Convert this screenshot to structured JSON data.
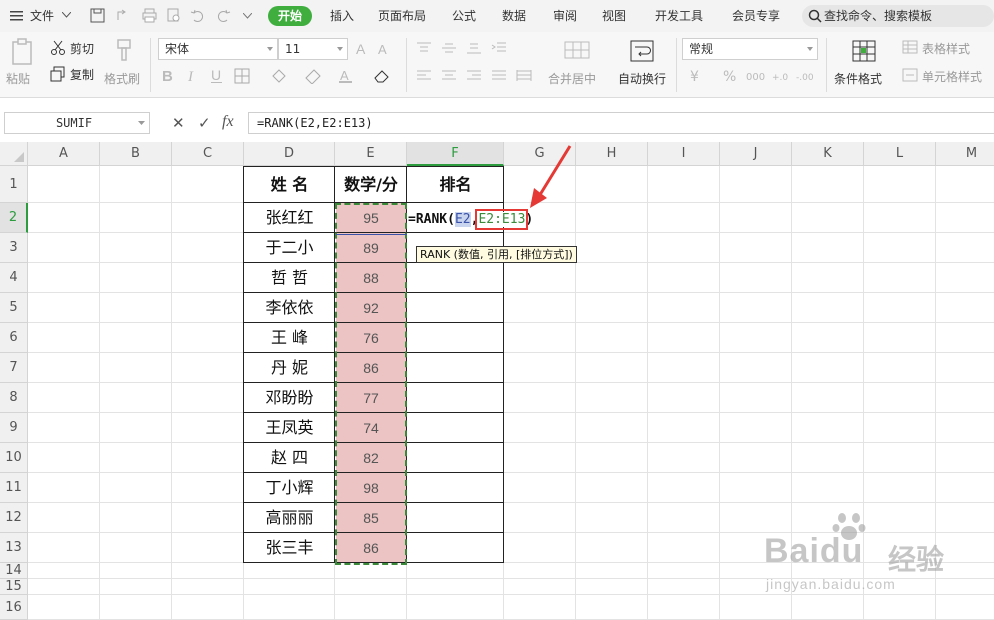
{
  "menubar": {
    "menu_label": "文件",
    "tabs": [
      {
        "label": "开始",
        "active": true
      },
      {
        "label": "插入"
      },
      {
        "label": "页面布局"
      },
      {
        "label": "公式"
      },
      {
        "label": "数据"
      },
      {
        "label": "审阅"
      },
      {
        "label": "视图"
      },
      {
        "label": "开发工具"
      },
      {
        "label": "会员专享"
      }
    ],
    "search_placeholder": "查找命令、搜索模板",
    "accent_color": "#3fae3f"
  },
  "ribbon": {
    "paste_label": "粘贴",
    "cut_label": "剪切",
    "copy_label": "复制",
    "format_painter_label": "格式刷",
    "font_name": "宋体",
    "font_size": "11",
    "merge_center_label": "合并居中",
    "wrap_text_label": "自动换行",
    "number_format": "常规",
    "conditional_format_label": "条件格式",
    "table_style_label": "表格样式",
    "cell_style_label": "单元格样式"
  },
  "formula_bar": {
    "name_box": "SUMIF",
    "cancel_symbol": "✕",
    "confirm_symbol": "✓",
    "fx_label": "fx",
    "formula": "=RANK(E2,E2:E13)"
  },
  "sheet": {
    "columns": [
      "A",
      "B",
      "C",
      "D",
      "E",
      "F",
      "G",
      "H",
      "I",
      "J",
      "K",
      "L",
      "M"
    ],
    "rows": [
      "1",
      "2",
      "3",
      "4",
      "5",
      "6",
      "7",
      "8",
      "9",
      "10",
      "11",
      "12",
      "13",
      "14",
      "15",
      "16"
    ],
    "header": {
      "name": "姓  名",
      "score": "数学/分",
      "rank": "排名"
    },
    "students": [
      {
        "name": "张红红",
        "score": "95"
      },
      {
        "name": "于二小",
        "score": "89"
      },
      {
        "name": "哲  哲",
        "score": "88"
      },
      {
        "name": "李依依",
        "score": "92"
      },
      {
        "name": "王  峰",
        "score": "76"
      },
      {
        "name": "丹  妮",
        "score": "86"
      },
      {
        "name": "邓盼盼",
        "score": "77"
      },
      {
        "name": "王凤英",
        "score": "74"
      },
      {
        "name": "赵  四",
        "score": "82"
      },
      {
        "name": "丁小辉",
        "score": "98"
      },
      {
        "name": "高丽丽",
        "score": "85"
      },
      {
        "name": "张三丰",
        "score": "86"
      }
    ],
    "edit_formula": {
      "prefix": "=RANK(",
      "ref1": "E2",
      "sep": ",",
      "ref2": "E2:E13",
      "suffix": ")"
    },
    "tooltip": "RANK (数值, 引用, [排位方式])",
    "selected_column": "F",
    "selected_row": "2",
    "highlight_color": "#ecc4c4"
  },
  "watermark": {
    "brand": "Baidu",
    "brand_cn": "经验",
    "url": "jingyan.baidu.com"
  }
}
